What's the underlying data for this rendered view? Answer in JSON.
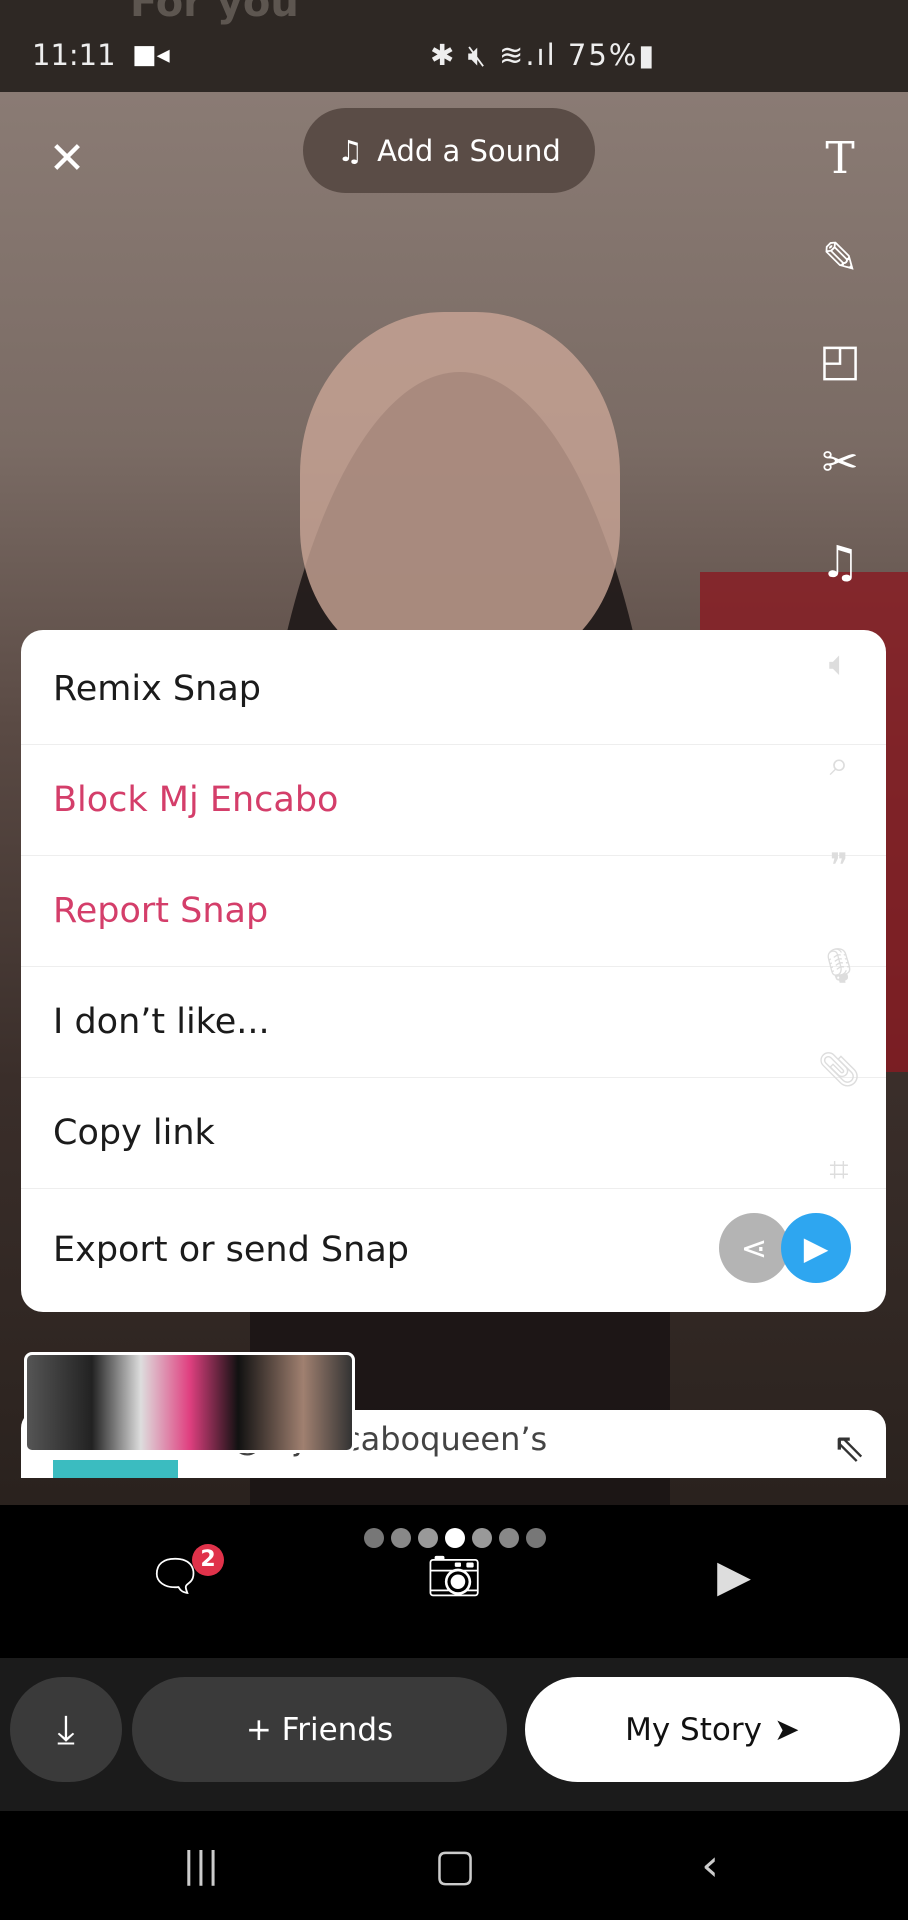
{
  "status_bar": {
    "header_behind": "For you",
    "time": "11:11",
    "battery": "75%",
    "icons": [
      "video-record-icon",
      "bluetooth-icon",
      "mute-icon",
      "wifi-icon",
      "signal-icon",
      "battery-icon"
    ]
  },
  "editor": {
    "close_icon": "close-icon",
    "add_sound_label": "Add a Sound",
    "tools": [
      "text-icon",
      "pencil-icon",
      "sticker-icon",
      "scissors-icon",
      "music-icon"
    ]
  },
  "menu": {
    "items": [
      {
        "label": "Remix Snap",
        "color": "#1b1b1b"
      },
      {
        "label": "Block Mj Encabo",
        "color": "#d43e6a"
      },
      {
        "label": "Report Snap",
        "color": "#d43e6a"
      },
      {
        "label": "I don’t like...",
        "color": "#1b1b1b"
      },
      {
        "label": "Copy link",
        "color": "#1b1b1b"
      },
      {
        "label": "Export or send Snap",
        "color": "#1b1b1b"
      }
    ]
  },
  "lower_card": {
    "handle": "@mjencaboqueen’s"
  },
  "bottom_nav": {
    "chat_badge": "2",
    "active_dot": 3,
    "dot_count": 7
  },
  "actions": {
    "friends_label": "+ Friends",
    "my_story_label": "My Story"
  },
  "accent": "#2ea6f0"
}
